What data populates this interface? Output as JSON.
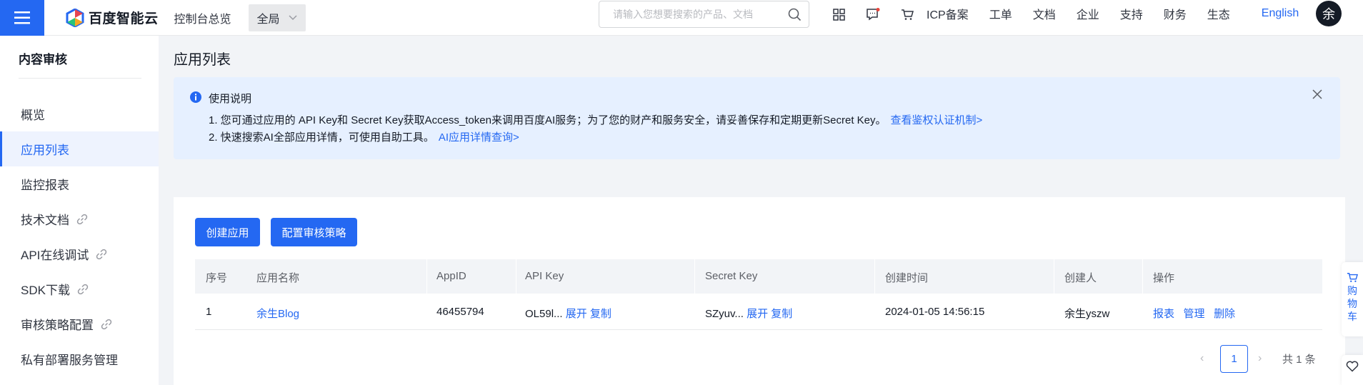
{
  "header": {
    "logo_text": "百度智能云",
    "console_link": "控制台总览",
    "region": "全局",
    "search_placeholder": "请输入您想要搜索的产品、文档",
    "nav": [
      "ICP备案",
      "工单",
      "文档",
      "企业",
      "支持",
      "财务",
      "生态"
    ],
    "language": "English",
    "avatar_initial": "余",
    "icons": [
      "menu-icon",
      "apps-icon",
      "message-icon",
      "cart-icon",
      "search-icon"
    ],
    "accent_color": "#2468f2"
  },
  "sidebar": {
    "title": "内容审核",
    "items": [
      {
        "label": "概览",
        "external": false,
        "active": false
      },
      {
        "label": "应用列表",
        "external": false,
        "active": true
      },
      {
        "label": "监控报表",
        "external": false,
        "active": false
      },
      {
        "label": "技术文档",
        "external": true,
        "active": false
      },
      {
        "label": "API在线调试",
        "external": true,
        "active": false
      },
      {
        "label": "SDK下载",
        "external": true,
        "active": false
      },
      {
        "label": "审核策略配置",
        "external": true,
        "active": false
      },
      {
        "label": "私有部署服务管理",
        "external": false,
        "active": false
      }
    ]
  },
  "main": {
    "title": "应用列表",
    "notice": {
      "title": "使用说明",
      "line1": "1. 您可通过应用的 API Key和 Secret Key获取Access_token来调用百度AI服务；为了您的财产和服务安全，请妥善保存和定期更新Secret Key。",
      "line1_link": "查看鉴权认证机制>",
      "line2": "2. 快速搜索AI全部应用详情，可使用自助工具。",
      "line2_link": "AI应用详情查询>"
    },
    "buttons": {
      "create": "创建应用",
      "configure": "配置审核策略"
    },
    "table": {
      "headers": [
        "序号",
        "应用名称",
        "AppID",
        "API Key",
        "Secret Key",
        "创建时间",
        "创建人",
        "操作"
      ],
      "rows": [
        {
          "index": "1",
          "name": "余生Blog",
          "app_id": "46455794",
          "api_key": "OL59l...",
          "secret_key": "SZyuv...",
          "expand_label": "展开",
          "copy_label": "复制",
          "created_at": "2024-01-05 14:56:15",
          "creator": "余生yszw",
          "actions": [
            "报表",
            "管理",
            "删除"
          ]
        }
      ]
    },
    "pagination": {
      "prev": "‹",
      "current_page": "1",
      "next": "›",
      "total": "共 1 条"
    }
  },
  "floating": {
    "cart_label": "购物车"
  }
}
